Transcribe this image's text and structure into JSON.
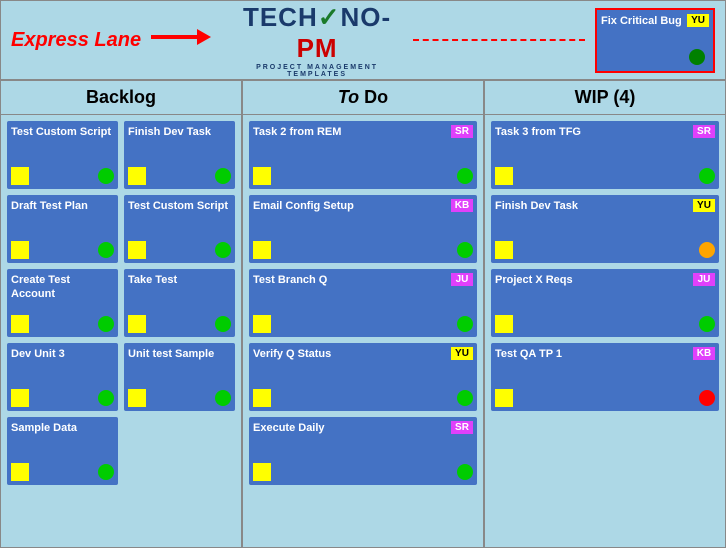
{
  "expressLane": {
    "label": "Express Lane",
    "arrowSymbol": "➜",
    "card": {
      "title": "Fix Critical Bug",
      "badge": "YU",
      "badgeType": "yellow",
      "dot": "green"
    }
  },
  "logo": {
    "techno": "TECHNO",
    "dash": "-",
    "pm": "PM",
    "subtitle": "PROJECT MANAGEMENT TEMPLATES"
  },
  "columns": [
    {
      "id": "backlog",
      "header": "Backlog",
      "subColumns": [
        {
          "cards": [
            {
              "title": "Test Custom Script",
              "badge": null,
              "dot": "green"
            },
            {
              "title": "Draft Test Plan",
              "badge": null,
              "dot": "green"
            },
            {
              "title": "Create Test Account",
              "badge": null,
              "dot": "green"
            },
            {
              "title": "Dev Unit 3",
              "badge": null,
              "dot": "green"
            },
            {
              "title": "Sample Data",
              "badge": null,
              "dot": "green"
            }
          ]
        },
        {
          "cards": [
            {
              "title": "Finish Dev Task",
              "badge": null,
              "dot": "green"
            },
            {
              "title": "Test Custom Script",
              "badge": null,
              "dot": "green"
            },
            {
              "title": "Take Test",
              "badge": null,
              "dot": "green"
            },
            {
              "title": "Unit test Sample",
              "badge": null,
              "dot": "green"
            }
          ]
        }
      ]
    },
    {
      "id": "todo",
      "header": "To Do",
      "subColumns": [
        {
          "cards": [
            {
              "title": "Task 2 from REM",
              "badge": "SR",
              "badgeType": "pink",
              "dot": "green"
            },
            {
              "title": "Email Config Setup",
              "badge": "KB",
              "badgeType": "pink",
              "dot": "green"
            },
            {
              "title": "Test Branch Q",
              "badge": "JU",
              "badgeType": "pink",
              "dot": "green"
            },
            {
              "title": "Verify Q Status",
              "badge": "YU",
              "badgeType": "yellow",
              "dot": "green"
            },
            {
              "title": "Execute Daily",
              "badge": "SR",
              "badgeType": "pink",
              "dot": "green"
            }
          ]
        }
      ]
    },
    {
      "id": "wip",
      "header": "WIP (4)",
      "subColumns": [
        {
          "cards": [
            {
              "title": "Task 3 from TFG",
              "badge": "SR",
              "badgeType": "pink",
              "dot": "green"
            },
            {
              "title": "Finish Dev Task",
              "badge": "YU",
              "badgeType": "yellow",
              "dot": "orange"
            },
            {
              "title": "Project X Reqs",
              "badge": "JU",
              "badgeType": "pink",
              "dot": "green"
            },
            {
              "title": "Test QA TP 1",
              "badge": "KB",
              "badgeType": "pink",
              "dot": "red"
            }
          ]
        }
      ]
    }
  ]
}
